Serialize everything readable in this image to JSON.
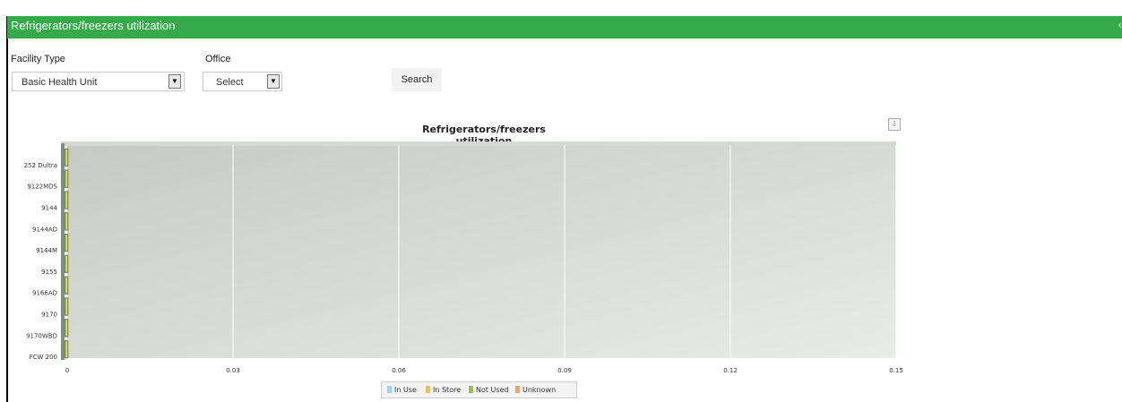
{
  "panel": {
    "title": "Refrigerators/freezers utilization",
    "collapse_icon": "chevron-icon"
  },
  "filters": {
    "facility_type": {
      "label": "Facility Type",
      "value": "Basic Health Unit"
    },
    "office": {
      "label": "Office",
      "value": "Select"
    },
    "search_label": "Search"
  },
  "chart": {
    "title": "Refrigerators/freezers utilization",
    "export_icon": "download-icon"
  },
  "chart_data": {
    "type": "bar",
    "orientation": "horizontal",
    "stacked": true,
    "title": "Refrigerators/freezers utilization",
    "categories": [
      "252 Dultra",
      "9122MDS",
      "9144",
      "9144AD",
      "9144M",
      "9155",
      "9166AD",
      "9170",
      "9170WBD",
      "FCW 200"
    ],
    "series": [
      {
        "name": "In Use",
        "color": "#9fd3f0",
        "values": [
          0,
          0,
          0,
          0,
          0,
          0,
          0,
          0,
          0,
          0
        ]
      },
      {
        "name": "In Store",
        "color": "#f2c23a",
        "values": [
          0,
          0,
          0,
          0,
          0,
          0,
          0,
          0,
          0,
          0
        ]
      },
      {
        "name": "Not Used",
        "color": "#8fc245",
        "values": [
          0,
          0,
          0,
          0,
          0,
          0,
          0,
          0,
          0,
          0
        ]
      },
      {
        "name": "Unknown",
        "color": "#f4a165",
        "values": [
          0,
          0,
          0,
          0,
          0,
          0,
          0,
          0,
          0,
          0
        ]
      }
    ],
    "x_ticks": [
      "0",
      "0.03",
      "0.06",
      "0.09",
      "0.12",
      "0.15"
    ],
    "xlim": [
      0,
      0.15
    ],
    "grid": true,
    "legend_position": "bottom-center"
  }
}
